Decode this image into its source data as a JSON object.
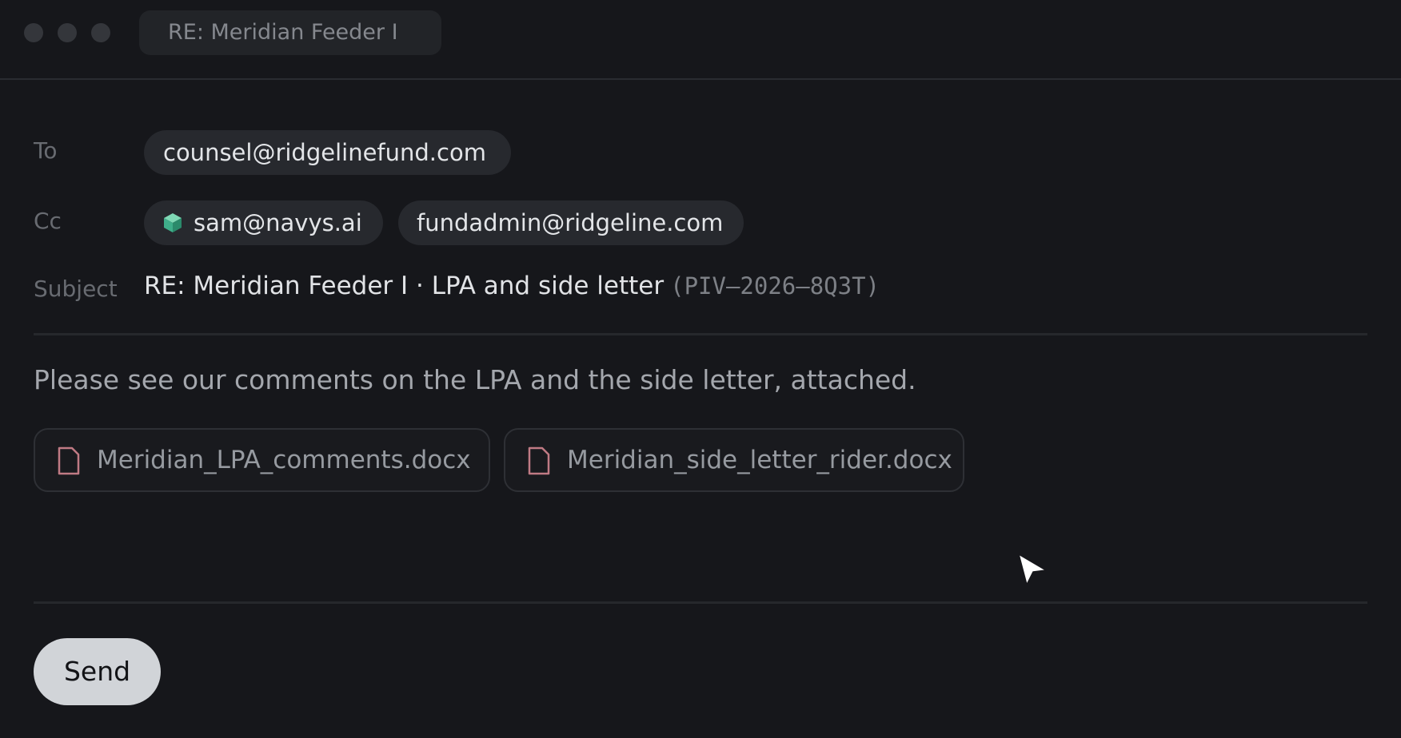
{
  "window": {
    "tab_title": "RE: Meridian Feeder I"
  },
  "compose": {
    "to_label": "To",
    "to_recipients": [
      "counsel@ridgelinefund.com"
    ],
    "cc_label": "Cc",
    "cc_recipients": [
      "sam@navys.ai",
      "fundadmin@ridgeline.com"
    ],
    "subject_label": "Subject",
    "subject": "RE: Meridian Feeder I · LPA and side letter",
    "subject_code": "(PIV–2026–8Q3T)",
    "body": "Please see our comments on the LPA and the side letter, attached.",
    "attachments": [
      {
        "name": "Meridian_LPA_comments.docx",
        "icon": "document-icon"
      },
      {
        "name": "Meridian_side_letter_rider.docx",
        "icon": "document-icon"
      }
    ],
    "send_label": "Send"
  },
  "colors": {
    "background": "#16171b",
    "chip": "#27292e",
    "attachment_icon": "#c07a84",
    "cube_icon": "#3fae8a",
    "send_button": "#d1d4d8"
  }
}
